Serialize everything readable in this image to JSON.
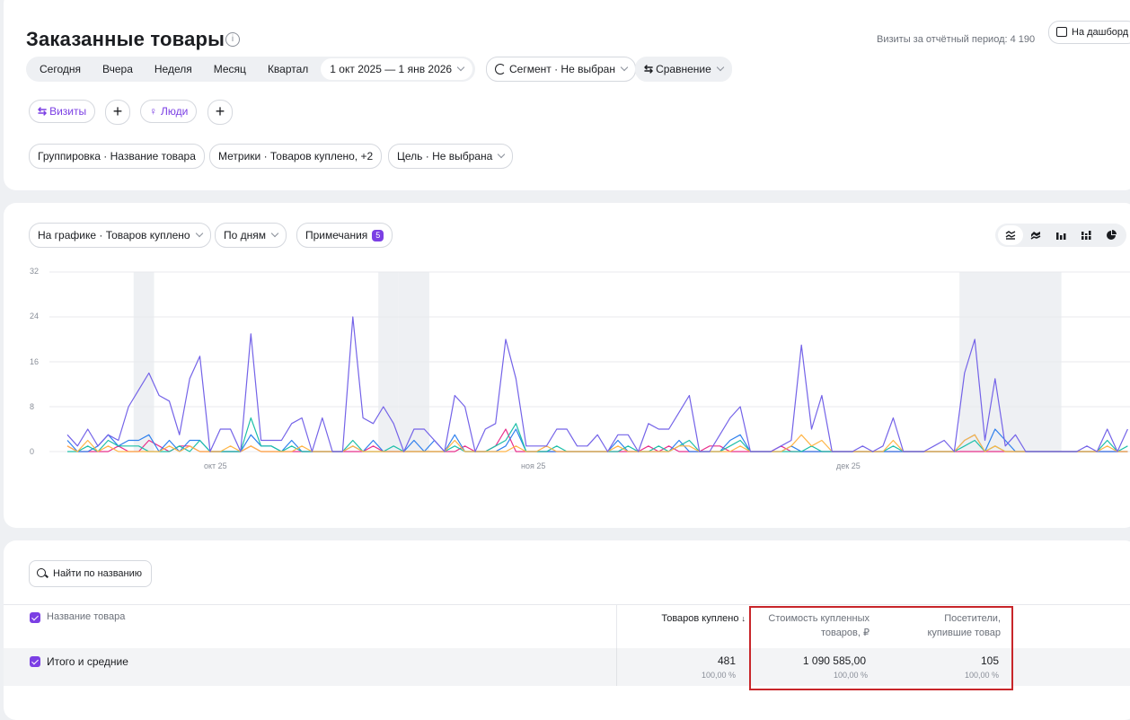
{
  "header": {
    "title": "Заказанные товары",
    "info_icon": "info-icon",
    "visits_period": "Визиты за отчётный период: 4 190",
    "dashboard_button": "На дашборд"
  },
  "period": {
    "items": [
      "Сегодня",
      "Вчера",
      "Неделя",
      "Месяц",
      "Квартал"
    ],
    "date_range": "1 окт 2025 — 1 янв 2026"
  },
  "segment": {
    "label": "Сегмент · Не выбран"
  },
  "comparison": {
    "label": "Сравнение"
  },
  "filters": {
    "visits": "Визиты",
    "people": "Люди"
  },
  "settings": {
    "grouping": "Группировка · Название товара",
    "metrics": "Метрики · Товаров куплено, +2",
    "goal": "Цель · Не выбрана"
  },
  "chart_controls": {
    "on_chart": "На графике · Товаров куплено",
    "by_days": "По дням",
    "notes": "Примечания",
    "notes_count": "5",
    "view_icons": [
      "area-chart-icon",
      "stacked-area-icon",
      "bar-chart-icon",
      "stacked-bar-icon",
      "pie-chart-icon"
    ]
  },
  "chart_data": {
    "type": "line",
    "ylim": [
      0,
      32
    ],
    "y_ticks": [
      "0",
      "8",
      "16",
      "24",
      "32"
    ],
    "x_tick_labels": [
      "окт 25",
      "ноя 25",
      "дек 25"
    ],
    "x_tick_days": [
      8,
      39,
      69
    ],
    "x_start": "2025-10-01",
    "x_end": "2026-01-01",
    "shaded_day_ranges": [
      [
        7,
        8
      ],
      [
        31,
        32
      ],
      [
        33,
        35
      ],
      [
        88,
        97
      ]
    ],
    "series": [
      {
        "color": "#7463e8",
        "values": [
          3,
          1,
          4,
          1,
          3,
          2,
          8,
          11,
          14,
          10,
          9,
          3,
          13,
          17,
          0,
          4,
          4,
          0,
          21,
          2,
          2,
          2,
          5,
          6,
          0,
          6,
          0,
          0,
          24,
          6,
          5,
          8,
          5,
          0,
          4,
          4,
          2,
          0,
          10,
          8,
          0,
          4,
          5,
          20,
          13,
          1,
          1,
          1,
          4,
          4,
          1,
          1,
          3,
          0,
          3,
          3,
          0,
          5,
          4,
          4,
          7,
          10,
          0,
          0,
          3,
          6,
          8,
          0,
          0,
          0,
          1,
          2,
          19,
          4,
          10,
          0,
          0,
          0,
          1,
          0,
          1,
          6,
          0,
          0,
          0,
          1,
          2,
          0,
          14,
          20,
          2,
          13,
          1,
          3,
          0,
          0,
          0,
          0,
          0,
          0,
          1,
          0,
          4,
          0,
          4
        ]
      },
      {
        "color": "#ffb547",
        "values": [
          1,
          0,
          2,
          0,
          1,
          0,
          0,
          0,
          0,
          0,
          1,
          0,
          1,
          0,
          0,
          0,
          1,
          0,
          1,
          0,
          0,
          0,
          0,
          1,
          0,
          0,
          0,
          0,
          1,
          0,
          0,
          0,
          0,
          0,
          0,
          0,
          0,
          0,
          2,
          0,
          0,
          0,
          0,
          0,
          1,
          0,
          0,
          1,
          0,
          0,
          0,
          0,
          0,
          0,
          1,
          0,
          0,
          0,
          0,
          0,
          1,
          1,
          0,
          0,
          0,
          0,
          1,
          0,
          0,
          0,
          0,
          1,
          3,
          1,
          2,
          0,
          0,
          0,
          0,
          0,
          0,
          2,
          0,
          0,
          0,
          0,
          0,
          0,
          2,
          3,
          0,
          1,
          0,
          0,
          0,
          0,
          0,
          0,
          0,
          0,
          0,
          0,
          1,
          0,
          0
        ]
      },
      {
        "color": "#1dbfa8",
        "values": [
          0,
          0,
          1,
          0,
          2,
          1,
          1,
          1,
          0,
          0,
          0,
          1,
          0,
          2,
          0,
          0,
          0,
          0,
          6,
          1,
          1,
          0,
          1,
          0,
          0,
          0,
          0,
          0,
          2,
          0,
          0,
          0,
          1,
          0,
          0,
          0,
          0,
          0,
          1,
          0,
          0,
          0,
          1,
          2,
          5,
          0,
          0,
          0,
          1,
          0,
          0,
          0,
          0,
          0,
          0,
          1,
          0,
          0,
          1,
          0,
          1,
          2,
          0,
          0,
          0,
          1,
          2,
          0,
          0,
          0,
          0,
          0,
          0,
          1,
          0,
          0,
          0,
          0,
          0,
          0,
          0,
          1,
          0,
          0,
          0,
          0,
          0,
          0,
          1,
          2,
          0,
          1,
          0,
          0,
          0,
          0,
          0,
          0,
          0,
          0,
          0,
          0,
          2,
          0,
          1
        ]
      },
      {
        "color": "#2f80ed",
        "values": [
          2,
          0,
          0,
          1,
          3,
          1,
          2,
          2,
          3,
          0,
          2,
          0,
          2,
          2,
          0,
          0,
          0,
          0,
          3,
          1,
          1,
          0,
          2,
          0,
          0,
          0,
          0,
          0,
          1,
          0,
          2,
          0,
          0,
          0,
          2,
          0,
          2,
          0,
          3,
          0,
          0,
          0,
          0,
          1,
          4,
          0,
          0,
          0,
          0,
          0,
          0,
          0,
          0,
          0,
          2,
          0,
          0,
          0,
          0,
          0,
          2,
          0,
          0,
          0,
          0,
          2,
          3,
          0,
          0,
          0,
          0,
          1,
          0,
          0,
          0,
          0,
          0,
          0,
          0,
          0,
          0,
          0,
          0,
          0,
          0,
          0,
          0,
          0,
          2,
          3,
          0,
          4,
          2,
          0,
          0,
          0,
          0,
          0,
          0,
          0,
          0,
          0,
          0,
          0,
          0
        ]
      },
      {
        "color": "#e8308c",
        "values": [
          1,
          0,
          0,
          0,
          0,
          1,
          0,
          0,
          2,
          1,
          0,
          1,
          1,
          0,
          0,
          0,
          0,
          0,
          1,
          0,
          0,
          0,
          0,
          0,
          0,
          0,
          0,
          0,
          0,
          0,
          1,
          0,
          0,
          0,
          0,
          0,
          0,
          0,
          0,
          1,
          0,
          0,
          1,
          4,
          0,
          0,
          0,
          0,
          0,
          0,
          0,
          0,
          0,
          0,
          0,
          0,
          0,
          1,
          0,
          1,
          0,
          0,
          0,
          1,
          1,
          0,
          0,
          0,
          0,
          0,
          1,
          0,
          0,
          0,
          0,
          0,
          0,
          0,
          0,
          0,
          0,
          0,
          0,
          0,
          0,
          0,
          0,
          0,
          0,
          0,
          0,
          0,
          0,
          0,
          0,
          0,
          0,
          0,
          0,
          0,
          0,
          0,
          0,
          0,
          0
        ]
      }
    ]
  },
  "table": {
    "search_placeholder": "Найти по названию",
    "col_name": "Название товара",
    "col_bought": "Товаров куплено",
    "col_bought_sort": "↓",
    "col_cost": [
      "Стоимость купленных",
      "товаров, ₽"
    ],
    "col_visitors": [
      "Посетители,",
      "купившие товар"
    ],
    "total_row": {
      "name": "Итого и средние",
      "bought": "481",
      "bought_pct": "100,00 %",
      "cost": "1 090 585,00",
      "cost_pct": "100,00 %",
      "visitors": "105",
      "visitors_pct": "100,00 %"
    }
  }
}
